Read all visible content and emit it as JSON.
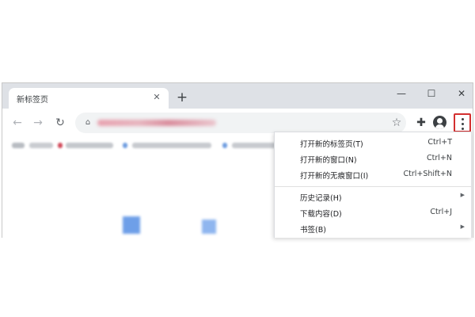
{
  "tab": {
    "title": "新标签页"
  },
  "menu": {
    "items": [
      {
        "label": "打开新的标签页(T)",
        "shortcut": "Ctrl+T"
      },
      {
        "label": "打开新的窗口(N)",
        "shortcut": "Ctrl+N"
      },
      {
        "label": "打开新的无痕窗口(I)",
        "shortcut": "Ctrl+Shift+N"
      },
      {
        "label": "历史记录(H)",
        "shortcut": ""
      },
      {
        "label": "下载内容(D)",
        "shortcut": "Ctrl+J"
      },
      {
        "label": "书签(B)",
        "shortcut": ""
      }
    ]
  },
  "icons": {
    "tab_close": "close-icon",
    "new_tab": "plus-icon",
    "minimize": "minimize-icon",
    "maximize": "maximize-icon",
    "close_window": "close-icon",
    "back": "arrow-left-icon",
    "forward": "arrow-right-icon",
    "reload": "reload-icon",
    "site_info": "site-info-icon",
    "bookmark_star": "star-icon",
    "extensions": "puzzle-icon",
    "profile": "profile-icon",
    "menu": "more-vertical-icon",
    "submenu_arrow": "triangle-right-icon"
  },
  "colors": {
    "titlebar": "#dee1e6",
    "highlight_border": "#d32f2f",
    "text": "#202124"
  }
}
